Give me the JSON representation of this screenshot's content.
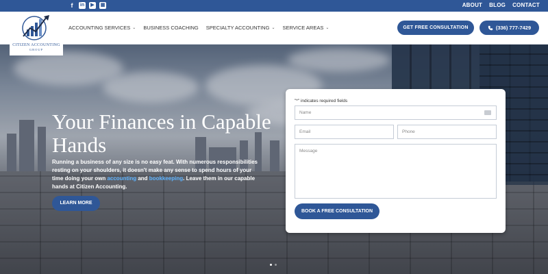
{
  "social": {
    "facebook": "f",
    "linkedin": "in",
    "youtube": "▶",
    "other": "▦"
  },
  "toplinks": [
    "ABOUT",
    "BLOG",
    "CONTACT"
  ],
  "logo": {
    "line1": "CITIZEN ACCOUNTING",
    "line2": "GROUP"
  },
  "nav": [
    {
      "label": "ACCOUNTING SERVICES",
      "dropdown": true
    },
    {
      "label": "BUSINESS COACHING",
      "dropdown": false
    },
    {
      "label": "SPECIALTY ACCOUNTING",
      "dropdown": true
    },
    {
      "label": "SERVICE AREAS",
      "dropdown": true
    }
  ],
  "header_buttons": {
    "consult": "GET FREE CONSULTATION",
    "phone": "(336) 777-7429"
  },
  "hero": {
    "title": "Your Finances in Capable Hands",
    "para_1": "Running a business of any size is no easy feat. With numerous responsibilities resting on your shoulders, it doesn't make any sense to spend hours of your time doing your own ",
    "link_1": "accounting",
    "and": " and ",
    "link_2": "bookkeeping",
    "para_2": ". Leave them in our capable hands at ",
    "bold_name": "Citizen Accounting",
    "para_end": ".",
    "learn_more": "LEARN MORE"
  },
  "form": {
    "required_note": "\"*\" indicates required fields",
    "name_placeholder": "Name",
    "email_placeholder": "Email",
    "phone_placeholder": "Phone",
    "message_placeholder": "Message",
    "submit": "BOOK A FREE CONSULTATION"
  },
  "colors": {
    "brand": "#2f5797",
    "link": "#5cb2ff"
  },
  "slider": {
    "active": 1,
    "count": 2
  }
}
